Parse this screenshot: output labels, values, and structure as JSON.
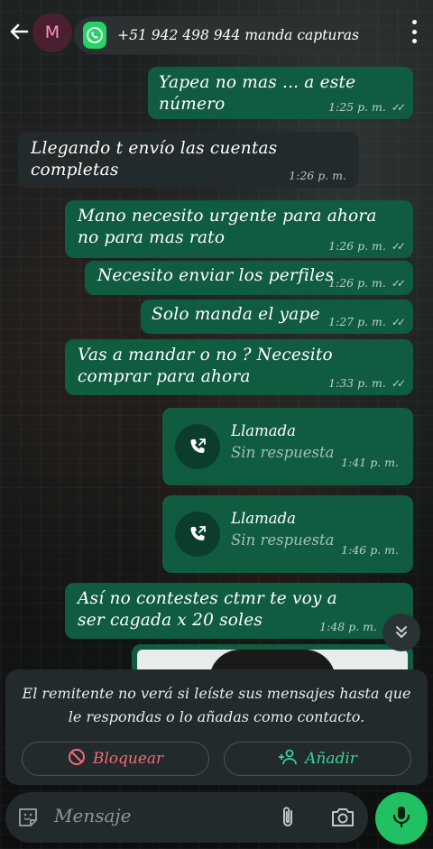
{
  "header": {
    "avatar_letter": "M",
    "title": "+51 942 498 944 manda capturas"
  },
  "messages": [
    {
      "type": "out",
      "text": "Yapea no mas ... a este número",
      "time": "1:25 p. m."
    },
    {
      "type": "in",
      "text": "Llegando t envío las cuentas completas",
      "time": "1:26 p. m."
    },
    {
      "type": "out",
      "text": "Mano necesito urgente para ahora no para mas rato",
      "time": "1:26 p. m."
    },
    {
      "type": "out",
      "text": "Necesito enviar los perfiles",
      "time": "1:26 p. m."
    },
    {
      "type": "out",
      "text": "Solo manda el yape",
      "time": "1:27 p. m."
    },
    {
      "type": "out",
      "text": "Vas a mandar o no ? Necesito comprar para ahora",
      "time": "1:33 p. m."
    },
    {
      "type": "call",
      "title": "Llamada",
      "status": "Sin respuesta",
      "time": "1:41 p. m."
    },
    {
      "type": "call",
      "title": "Llamada",
      "status": "Sin respuesta",
      "time": "1:46 p. m."
    },
    {
      "type": "out",
      "text": "Así no contestes ctmr te voy a ser cagada x 20 soles",
      "time": "1:48 p. m."
    }
  ],
  "notice": {
    "text": "El remitente no verá si leíste sus mensajes hasta que le respondas o lo añadas como contacto.",
    "block_label": "Bloquear",
    "add_label": "Añadir"
  },
  "composer": {
    "placeholder": "Mensaje"
  },
  "colors": {
    "outgoing_bubble": "#105c40",
    "incoming_bubble": "#232a2b",
    "accent_green": "#21c063",
    "block_red": "#f26a75"
  },
  "icons": [
    "back-arrow-icon",
    "whatsapp-icon",
    "more-vert-icon",
    "call-missed-icon",
    "double-chevron-down-icon",
    "block-icon",
    "add-contact-icon",
    "sticker-icon",
    "attach-clip-icon",
    "camera-icon",
    "mic-icon"
  ]
}
